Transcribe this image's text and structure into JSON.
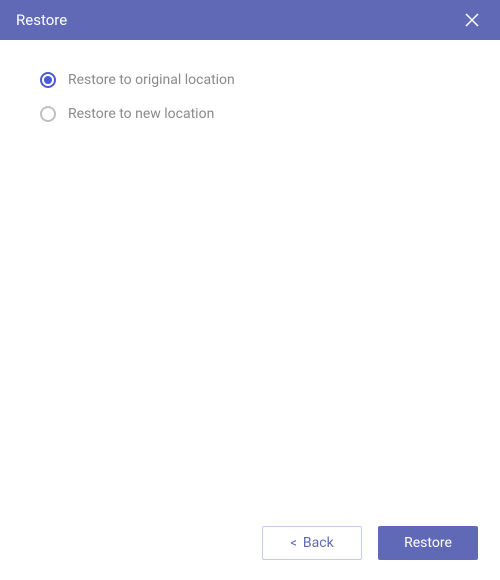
{
  "header": {
    "title": "Restore"
  },
  "options": {
    "original": {
      "label": "Restore to original location",
      "selected": true
    },
    "new": {
      "label": "Restore to new location",
      "selected": false
    }
  },
  "footer": {
    "back_chevron": "<",
    "back_label": "Back",
    "primary_label": "Restore"
  }
}
